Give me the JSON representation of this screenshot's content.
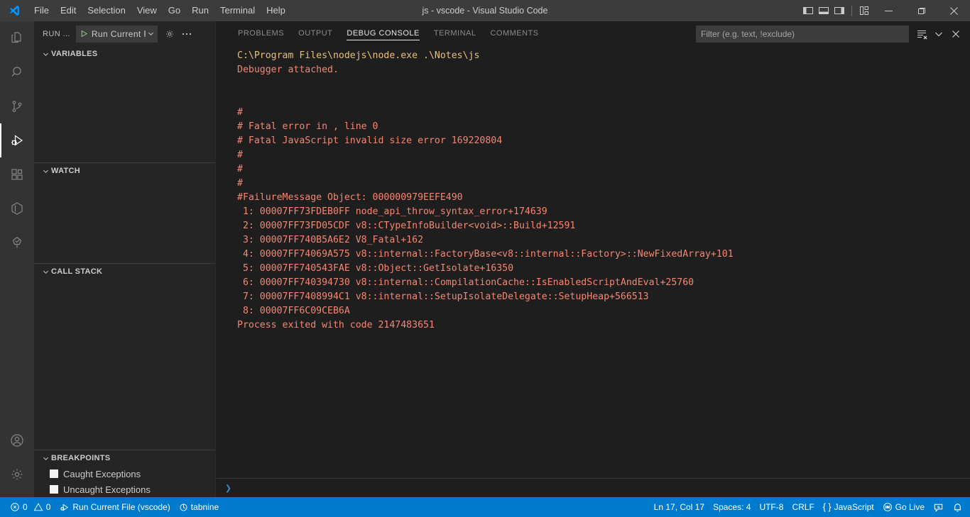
{
  "window": {
    "title": "js - vscode - Visual Studio Code",
    "menus": [
      "File",
      "Edit",
      "Selection",
      "View",
      "Go",
      "Run",
      "Terminal",
      "Help"
    ],
    "layout_buttons": [
      {
        "name": "toggle-primary-sidebar-icon",
        "label": "Toggle Primary Side Bar"
      },
      {
        "name": "toggle-panel-icon",
        "label": "Toggle Panel"
      },
      {
        "name": "toggle-secondary-sidebar-icon",
        "label": "Toggle Secondary Side Bar"
      },
      {
        "name": "customize-layout-icon",
        "label": "Customize Layout"
      }
    ],
    "controls": [
      {
        "name": "minimize-button",
        "glyph": "─"
      },
      {
        "name": "maximize-button",
        "glyph": "❐"
      },
      {
        "name": "close-button",
        "glyph": "✕"
      }
    ]
  },
  "activitybar": {
    "items": [
      {
        "name": "explorer",
        "label": "Explorer",
        "active": false
      },
      {
        "name": "search",
        "label": "Search",
        "active": false
      },
      {
        "name": "source-control",
        "label": "Source Control",
        "active": false
      },
      {
        "name": "run-and-debug",
        "label": "Run and Debug",
        "active": true
      },
      {
        "name": "extensions",
        "label": "Extensions",
        "active": false
      },
      {
        "name": "docker",
        "label": "Docker",
        "active": false
      },
      {
        "name": "test-explorer",
        "label": "Testing",
        "active": false
      }
    ],
    "bottom": [
      {
        "name": "accounts",
        "label": "Accounts"
      },
      {
        "name": "manage",
        "label": "Manage"
      }
    ]
  },
  "sidebar": {
    "title": "RUN ...",
    "launch_config": "Run Current F",
    "header_actions": [
      {
        "name": "open-launch-json",
        "label": "Open launch.json"
      },
      {
        "name": "views-and-more-actions",
        "label": "Views and More Actions..."
      }
    ],
    "sections": [
      {
        "name": "variables",
        "label": "VARIABLES"
      },
      {
        "name": "watch",
        "label": "WATCH"
      },
      {
        "name": "call-stack",
        "label": "CALL STACK"
      },
      {
        "name": "breakpoints",
        "label": "BREAKPOINTS"
      }
    ],
    "breakpoints": [
      {
        "label": "Caught Exceptions",
        "checked": false
      },
      {
        "label": "Uncaught Exceptions",
        "checked": false
      }
    ]
  },
  "panel": {
    "tabs": [
      {
        "name": "problems",
        "label": "PROBLEMS",
        "active": false
      },
      {
        "name": "output",
        "label": "OUTPUT",
        "active": false
      },
      {
        "name": "debug-console",
        "label": "DEBUG CONSOLE",
        "active": true
      },
      {
        "name": "terminal",
        "label": "TERMINAL",
        "active": false
      },
      {
        "name": "comments",
        "label": "COMMENTS",
        "active": false
      }
    ],
    "filter_placeholder": "Filter (e.g. text, !exclude)",
    "filter_value": "",
    "actions": [
      {
        "name": "clear-console-icon",
        "label": "Clear Console"
      },
      {
        "name": "chevron-down-icon",
        "label": "Views and More Actions..."
      },
      {
        "name": "close-panel-icon",
        "label": "Close Panel"
      }
    ],
    "repl_prompt": "❯"
  },
  "console": {
    "colors": {
      "command": "#e5c07b",
      "error": "#f48771"
    },
    "lines": [
      {
        "text": "C:\\Program Files\\nodejs\\node.exe .\\Notes\\js",
        "color": "command"
      },
      {
        "text": "Debugger attached.",
        "color": "error"
      },
      {
        "text": "",
        "color": "error"
      },
      {
        "text": "",
        "color": "error"
      },
      {
        "text": "#",
        "color": "error"
      },
      {
        "text": "# Fatal error in , line 0",
        "color": "error"
      },
      {
        "text": "# Fatal JavaScript invalid size error 169220804",
        "color": "error"
      },
      {
        "text": "#",
        "color": "error"
      },
      {
        "text": "#",
        "color": "error"
      },
      {
        "text": "#",
        "color": "error"
      },
      {
        "text": "#FailureMessage Object: 000000979EEFE490",
        "color": "error"
      },
      {
        "text": " 1: 00007FF73FDEB0FF node_api_throw_syntax_error+174639",
        "color": "error"
      },
      {
        "text": " 2: 00007FF73FD05CDF v8::CTypeInfoBuilder<void>::Build+12591",
        "color": "error"
      },
      {
        "text": " 3: 00007FF740B5A6E2 V8_Fatal+162",
        "color": "error"
      },
      {
        "text": " 4: 00007FF74069A575 v8::internal::FactoryBase<v8::internal::Factory>::NewFixedArray+101",
        "color": "error"
      },
      {
        "text": " 5: 00007FF740543FAE v8::Object::GetIsolate+16350",
        "color": "error"
      },
      {
        "text": " 6: 00007FF740394730 v8::internal::CompilationCache::IsEnabledScriptAndEval+25760",
        "color": "error"
      },
      {
        "text": " 7: 00007FF7408994C1 v8::internal::SetupIsolateDelegate::SetupHeap+566513",
        "color": "error"
      },
      {
        "text": " 8: 00007FF6C09CEB6A",
        "color": "error"
      },
      {
        "text": "Process exited with code 2147483651",
        "color": "error"
      }
    ]
  },
  "statusbar": {
    "left": [
      {
        "name": "problems-status",
        "icon": "error-warning-icon",
        "label": "0  ⚠ 0",
        "errors": "0",
        "warnings": "0"
      },
      {
        "name": "debug-launch-status",
        "icon": "debug-alt-icon",
        "label": "Run Current File (vscode)"
      },
      {
        "name": "tabnine-status",
        "icon": "tabnine-icon",
        "label": "tabnine"
      }
    ],
    "right": [
      {
        "name": "editor-position",
        "label": "Ln 17, Col 17"
      },
      {
        "name": "editor-indentation",
        "label": "Spaces: 4"
      },
      {
        "name": "editor-encoding",
        "label": "UTF-8"
      },
      {
        "name": "editor-eol",
        "label": "CRLF"
      },
      {
        "name": "editor-language",
        "label": "JavaScript",
        "icon": "braces-icon"
      },
      {
        "name": "go-live",
        "label": "Go Live",
        "icon": "broadcast-icon"
      },
      {
        "name": "feedback",
        "label": "",
        "icon": "feedback-icon"
      },
      {
        "name": "notifications",
        "label": "",
        "icon": "bell-icon"
      }
    ],
    "background": "#007acc"
  }
}
